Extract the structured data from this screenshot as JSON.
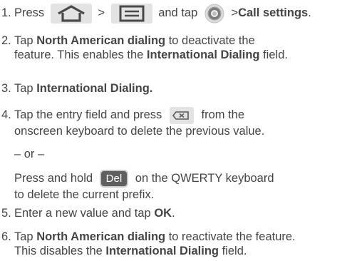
{
  "steps": [
    {
      "num": "1.",
      "parts": {
        "a": "Press",
        "gt1": ">",
        "b": "and tap",
        "gt2": ">",
        "c": "Call settings",
        "d": "."
      },
      "icons": [
        "home-key-icon",
        "menu-key-icon",
        "settings-gear-icon"
      ]
    },
    {
      "num": "2.",
      "line1": {
        "a": "Tap ",
        "b": "North American dialing",
        "c": " to deactivate the"
      },
      "line2": {
        "a": "feature. This enables the ",
        "b": "International Dialing",
        "c": " field."
      }
    },
    {
      "num": "3.",
      "line1": {
        "a": "Tap ",
        "b": "International Dialing."
      }
    },
    {
      "num": "4.",
      "line1": {
        "a": "Tap the entry field and press",
        "b": "from the"
      },
      "line2": "onscreen keyboard to delete the previous value.",
      "or": "– or –",
      "line3": {
        "a": "Press and hold",
        "key": "Del",
        "b": "on the QWERTY keyboard"
      },
      "line4": "to delete the current prefix."
    },
    {
      "num": "5.",
      "line1": {
        "a": "Enter a new value and tap ",
        "b": "OK",
        "c": "."
      }
    },
    {
      "num": "6.",
      "line1": {
        "a": "Tap ",
        "b": "North American dialing",
        "c": " to reactivate the feature."
      },
      "line2": {
        "a": "This disables the ",
        "b": "International Dialing",
        "c": " field."
      }
    }
  ],
  "colors": {
    "text": "#454545",
    "icon_fill": "#5a5a5a",
    "icon_bg": "#e3e3e3",
    "del_key_bg": "#5f5f5f"
  }
}
